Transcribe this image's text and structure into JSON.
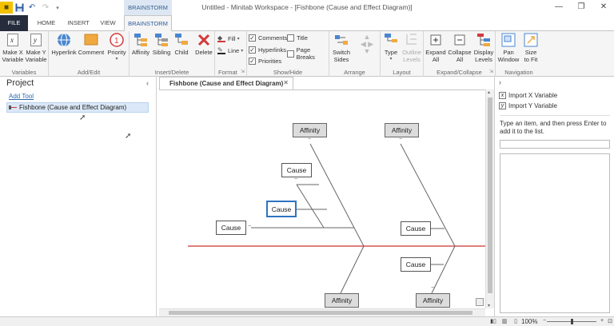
{
  "window": {
    "title": "Untitled - Minitab Workspace - [Fishbone (Cause and Effect Diagram)]",
    "context_tab": "BRAINSTORM",
    "controls": [
      "—",
      "❐",
      "✕"
    ]
  },
  "tabs": [
    {
      "label": "FILE"
    },
    {
      "label": "HOME"
    },
    {
      "label": "INSERT"
    },
    {
      "label": "VIEW"
    },
    {
      "label": "BRAINSTORM"
    }
  ],
  "ribbon": {
    "variables": {
      "label": "Variables",
      "make_x": "Make X\nVariable",
      "make_y": "Make Y\nVariable"
    },
    "addedit": {
      "label": "Add/Edit",
      "hyperlink": "Hyperlink",
      "comment": "Comment",
      "priority": "Priority"
    },
    "insertdelete": {
      "label": "Insert/Delete",
      "affinity": "Affinity",
      "sibling": "Sibling",
      "child": "Child",
      "delete": "Delete"
    },
    "format": {
      "label": "Format",
      "fill": "Fill",
      "line": "Line"
    },
    "showhide": {
      "label": "Show/Hide",
      "comments": "Comments",
      "hyperlinks": "Hyperlinks",
      "priorities": "Priorities",
      "title": "Title",
      "page_breaks": "Page Breaks"
    },
    "arrange": {
      "label": "Arrange",
      "switch_sides": "Switch\nSides"
    },
    "layout": {
      "label": "Layout",
      "type": "Type",
      "outline_levels": "Outline\nLevels"
    },
    "expand": {
      "label": "Expand/Collapse",
      "expand_all": "Expand\nAll",
      "collapse_all": "Collapse\nAll",
      "display_levels": "Display\nLevels"
    },
    "navigation": {
      "label": "Navigation",
      "pan_window": "Pan\nWindow",
      "size_to_fit": "Size\nto Fit"
    }
  },
  "project": {
    "title": "Project",
    "add_tool": "Add Tool",
    "item": "Fishbone (Cause and Effect Diagram)"
  },
  "document": {
    "tab_label": "Fishbone (Cause and Effect Diagram)"
  },
  "diagram": {
    "affinity_label": "Affinity",
    "cause_label": "Cause",
    "collapse_glyph": "−"
  },
  "right_panel": {
    "import_x": "Import X Variable",
    "import_y": "Import Y Variable",
    "help": "Type an item, and then press Enter to add it to the list."
  },
  "status": {
    "zoom": "100%"
  },
  "colors": {
    "file_tab": "#262c3c",
    "accent": "#2f74c0",
    "spine": "#cc3333",
    "selection_bg": "#dbe8f7"
  }
}
